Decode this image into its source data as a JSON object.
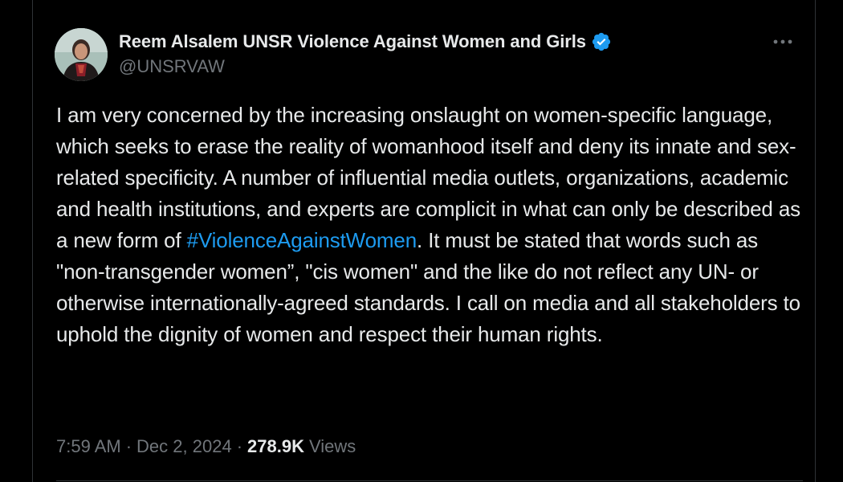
{
  "author": {
    "name": "Reem Alsalem UNSR Violence Against Women and Girls",
    "handle": "@UNSRVAW",
    "verified_badge_icon": "verified-badge-icon",
    "avatar": "avatar"
  },
  "menu": {
    "more_icon": "more-horizontal-icon"
  },
  "tweet": {
    "text_before_hashtag": "I am very concerned by the increasing onslaught on women-specific language, which seeks to erase the reality of womanhood itself and deny its innate and sex-related specificity. A number of influential media outlets, organizations, academic and health institutions, and experts are complicit in what can only be described as a new form of ",
    "hashtag": "#ViolenceAgainstWomen",
    "text_after_hashtag": ". It must be stated that words such as \"non-transgender women”, \"cis women\" and the like do not reflect any UN- or otherwise internationally-agreed standards. I call on media and all stakeholders to uphold the dignity of women and respect their human rights."
  },
  "meta": {
    "time": "7:59 AM",
    "separator": "·",
    "date": "Dec 2, 2024",
    "view_count": "278.9K",
    "views_label": "Views"
  },
  "colors": {
    "background": "#000000",
    "text_primary": "#e7e9ea",
    "text_secondary": "#71767b",
    "link": "#1d9bf0",
    "verified": "#1d9bf0",
    "border": "#2f3336"
  }
}
